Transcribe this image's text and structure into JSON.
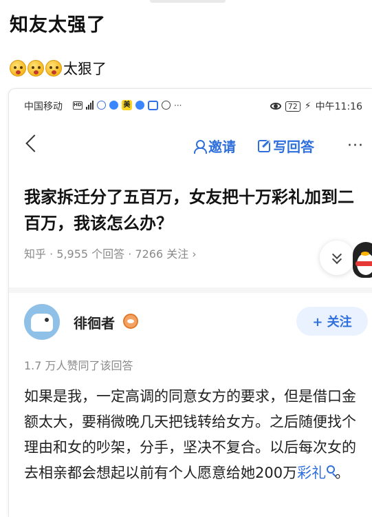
{
  "post": {
    "title": "知友太强了",
    "caption": "太狠了",
    "emoji_count": 3,
    "emoji_icon": "surprised-face-emoji"
  },
  "screenshot": {
    "statusbar": {
      "carrier": "中国移动",
      "battery": "72",
      "time": "中午11:16",
      "more": "···"
    },
    "navbar": {
      "invite_label": "邀请",
      "write_label": "写回答",
      "more_label": "···"
    },
    "question": {
      "title": "我家拆迁分了五百万，女友把十万彩礼加到二百万，我该怎么办？",
      "meta": "知乎 · 5,955 个回答 · 7266 关注 ›"
    },
    "author": {
      "name": "徘徊者",
      "follow_label": "+ 关注"
    },
    "likes": "1.7 万人赞同了该回答",
    "answer": {
      "text": "如果是我，一定高调的同意女方的要求，但是借口金额太大，要稍微晚几天把钱转给女方。之后随便找个理由和女的吵架，分手，坚决不复合。以后每次女的去相亲都会想起以前有个人愿意给她200万",
      "link_text": "彩礼",
      "end": "。"
    },
    "colors": {
      "accent": "#2e6fdc",
      "meta_gray": "#8a8a8a"
    }
  }
}
